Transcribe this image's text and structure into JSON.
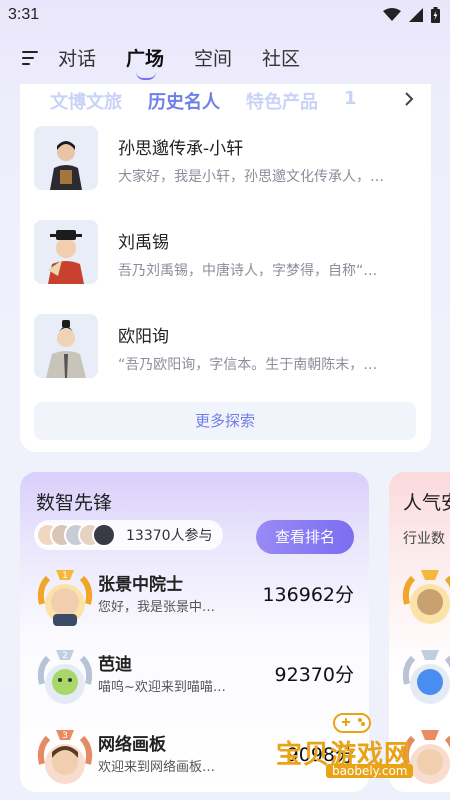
{
  "status_bar": {
    "time": "3:31"
  },
  "nav": {
    "tabs": [
      {
        "label": "对话"
      },
      {
        "label": "广场"
      },
      {
        "label": "空间"
      },
      {
        "label": "社区"
      }
    ],
    "active_tab": "广场"
  },
  "categories": {
    "tabs": [
      {
        "label": "文博文旅"
      },
      {
        "label": "历史名人"
      },
      {
        "label": "特色产品"
      },
      {
        "label": "1"
      }
    ],
    "active": "历史名人"
  },
  "people": [
    {
      "name": "孙思邈传承-小轩",
      "desc": "大家好，我是小轩，孙思邈文化传承人，…"
    },
    {
      "name": "刘禹锡",
      "desc": "吾乃刘禹锡，中唐诗人，字梦得，自称“…"
    },
    {
      "name": "欧阳询",
      "desc": "“吾乃欧阳询，字信本。生于南朝陈末，…"
    }
  ],
  "explore_label": "更多探索",
  "ranking": {
    "title": "数智先锋",
    "participants": "13370人参与",
    "button": "查看排名",
    "rows": [
      {
        "rank": "1",
        "name": "张景中院士",
        "desc": "您好，我是张景中…",
        "score": "136962分"
      },
      {
        "rank": "2",
        "name": "芭迪",
        "desc": "喵呜~欢迎来到喵喵…",
        "score": "92370分"
      },
      {
        "rank": "3",
        "name": "网络画板",
        "desc": "欢迎来到网络画板…",
        "score": "9098分"
      }
    ]
  },
  "popular": {
    "title": "人气安",
    "subtitle": "行业数"
  },
  "watermark": {
    "text": "宝贝游戏网",
    "url": "baobely.com"
  },
  "colors": {
    "accent": "#6f7fe8",
    "button_purple": "#7b6ef0",
    "gold": "#e8a317"
  }
}
